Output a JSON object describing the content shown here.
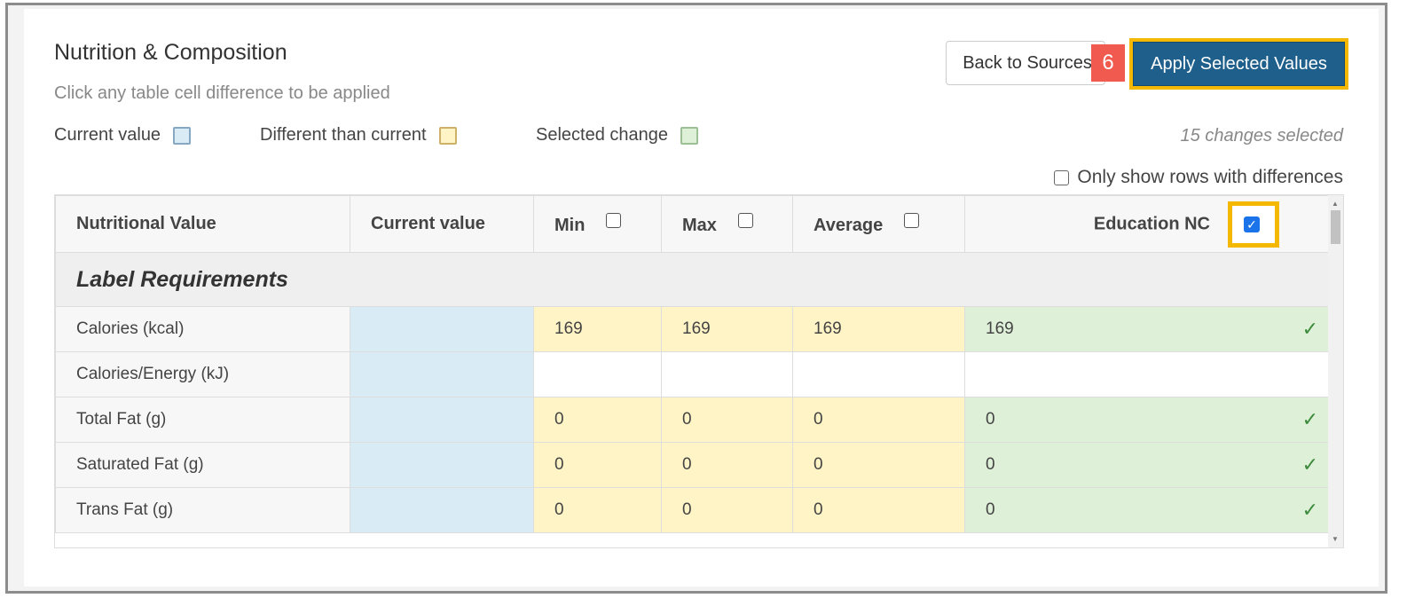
{
  "header": {
    "title": "Nutrition & Composition",
    "subtitle": "Click any table cell difference to be applied"
  },
  "legend": {
    "current": "Current value",
    "different": "Different than current",
    "selected": "Selected change"
  },
  "toolbar": {
    "back_label": "Back to Sources",
    "step_badge": "6",
    "apply_label": "Apply Selected Values"
  },
  "status": {
    "changes_selected": "15 changes selected"
  },
  "filter": {
    "only_rows_label": "Only show rows with differences"
  },
  "table": {
    "headers": {
      "nutritional_value": "Nutritional Value",
      "current_value": "Current value",
      "min": "Min",
      "max": "Max",
      "average": "Average",
      "education_nc": "Education NC"
    },
    "section": "Label Requirements",
    "rows": [
      {
        "label": "Calories (kcal)",
        "min": "169",
        "max": "169",
        "average": "169",
        "education_nc": "169",
        "selected": true
      },
      {
        "label": "Calories/Energy (kJ)",
        "min": "",
        "max": "",
        "average": "",
        "education_nc": "",
        "selected": false
      },
      {
        "label": "Total Fat (g)",
        "min": "0",
        "max": "0",
        "average": "0",
        "education_nc": "0",
        "selected": true
      },
      {
        "label": "Saturated Fat (g)",
        "min": "0",
        "max": "0",
        "average": "0",
        "education_nc": "0",
        "selected": true
      },
      {
        "label": "Trans Fat (g)",
        "min": "0",
        "max": "0",
        "average": "0",
        "education_nc": "0",
        "selected": true
      }
    ],
    "check_glyph": "✓"
  },
  "colors": {
    "current": "#d9ebf5",
    "different": "#fff4c6",
    "selected": "#dff0d8",
    "apply_button": "#1f5f8b",
    "highlight": "#f5b800",
    "badge": "#f05a4f"
  }
}
